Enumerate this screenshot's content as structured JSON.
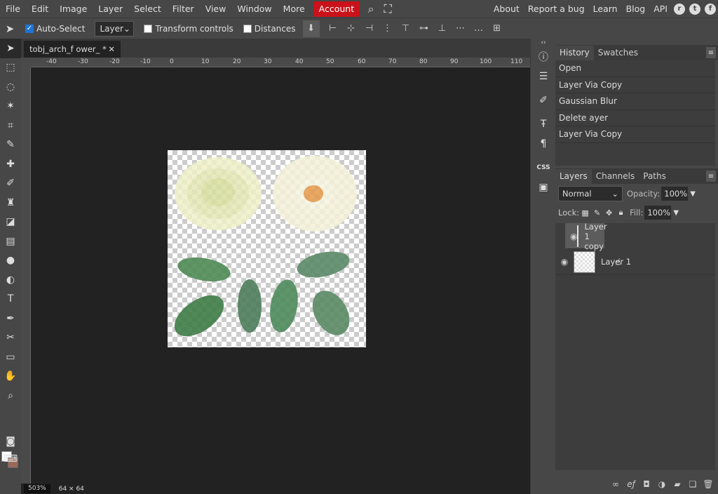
{
  "menu": {
    "items": [
      "File",
      "Edit",
      "Image",
      "Layer",
      "Select",
      "Filter",
      "View",
      "Window",
      "More"
    ],
    "account": "Account",
    "right": [
      "About",
      "Report a bug",
      "Learn",
      "Blog",
      "API"
    ]
  },
  "options": {
    "auto_select": "Auto-Select",
    "layer_select": "Layer",
    "transform_controls": "Transform controls",
    "distances": "Distances"
  },
  "document": {
    "tab_title": "tobj_arch_f ower_ *",
    "zoom": "503%",
    "dims": "64 × 64",
    "ruler_labels": [
      "-40",
      "-30",
      "-20",
      "-10",
      "0",
      "10",
      "20",
      "30",
      "40",
      "50",
      "60",
      "70",
      "80",
      "90",
      "100",
      "110"
    ]
  },
  "history": {
    "tabs": [
      "History",
      "Swatches"
    ],
    "items": [
      "Open",
      "Layer Via Copy",
      "Gaussian Blur",
      "Delete ayer",
      "Layer Via Copy"
    ]
  },
  "layers_panel": {
    "tabs": [
      "Layers",
      "Channels",
      "Paths"
    ],
    "blend_mode": "Normal",
    "opacity_label": "Opacity:",
    "opacity": "100%",
    "lock_label": "Lock:",
    "fill_label": "Fill:",
    "fill": "100%",
    "layers": [
      {
        "name": "Layer 1 copy",
        "selected": true
      },
      {
        "name": "Layer 1",
        "selected": false
      }
    ]
  }
}
